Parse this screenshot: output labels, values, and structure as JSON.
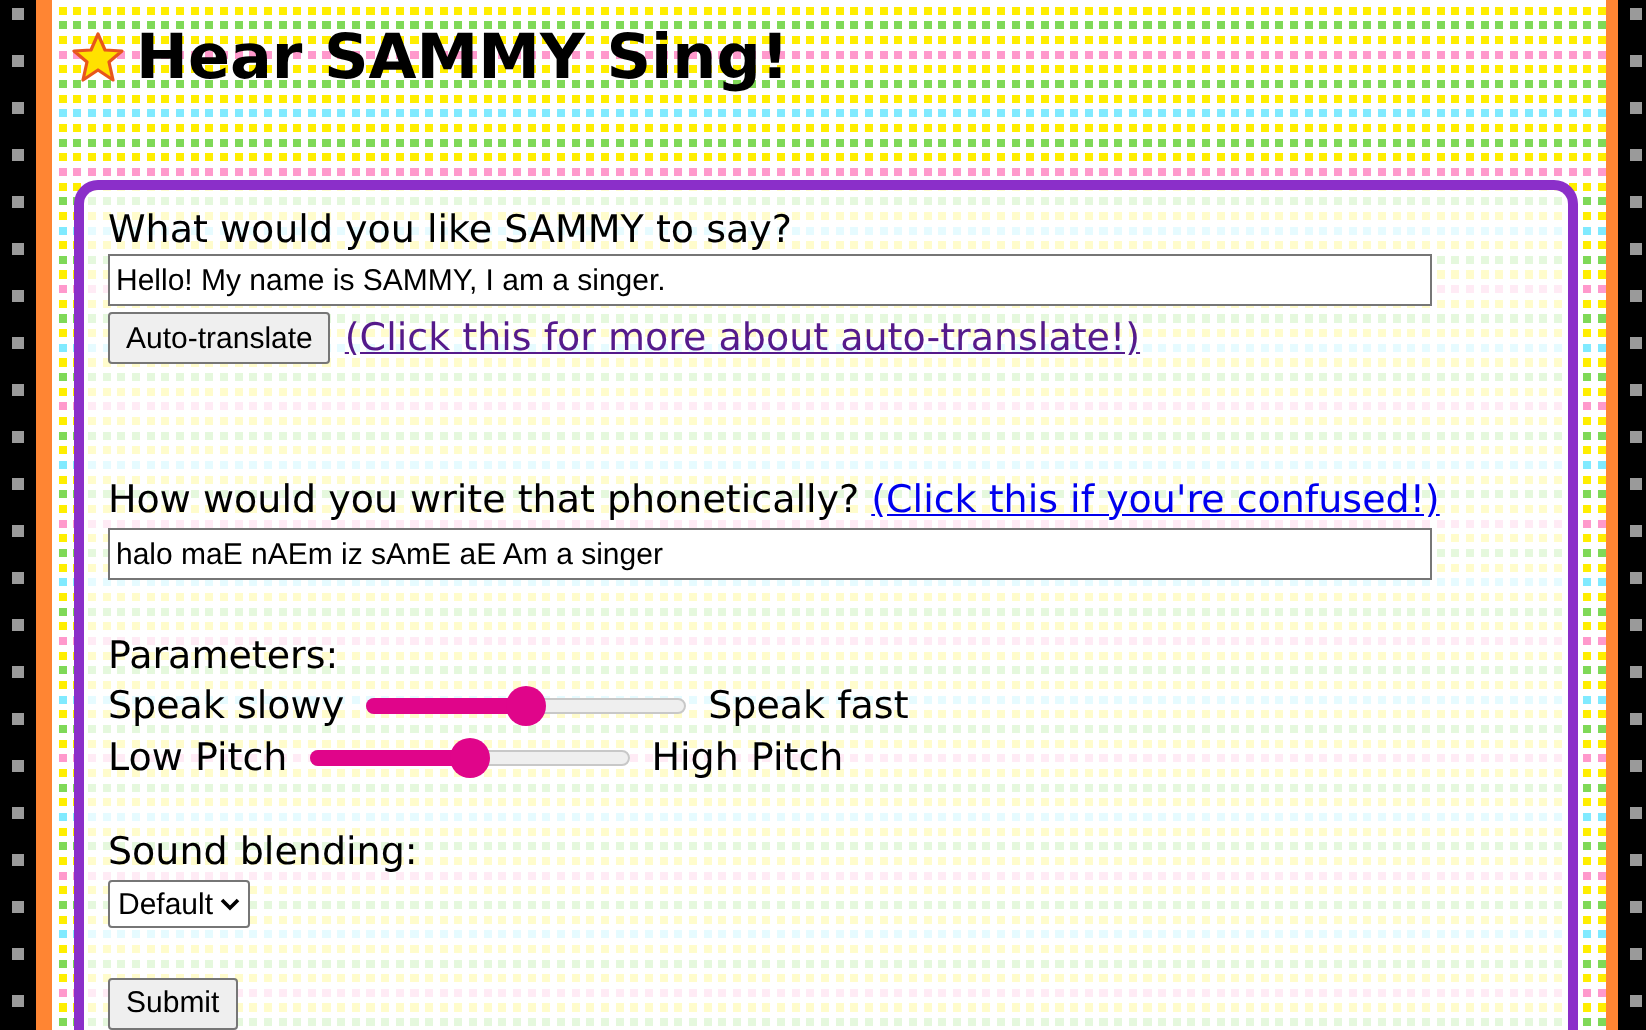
{
  "title": "Hear SAMMY Sing!",
  "say": {
    "label": "What would you like SAMMY to say?",
    "value": "Hello! My name is SAMMY, I am a singer.",
    "button": "Auto-translate",
    "link": {
      "text": "(Click this for more about auto-translate!)",
      "visited": true
    }
  },
  "phonetic": {
    "label": "How would you write that phonetically?",
    "link": {
      "text": "(Click this if you're confused!)",
      "visited": false
    },
    "value": "halo maE nAEm iz sAmE aE Am a singer"
  },
  "parameters": {
    "label": "Parameters:",
    "sliders": [
      {
        "low": "Speak slowy",
        "high": "Speak fast",
        "level": 0.5
      },
      {
        "low": "Low Pitch",
        "high": "High Pitch",
        "level": 0.5
      }
    ]
  },
  "blending": {
    "label": "Sound blending:",
    "value": "Default"
  },
  "submit": "Submit"
}
